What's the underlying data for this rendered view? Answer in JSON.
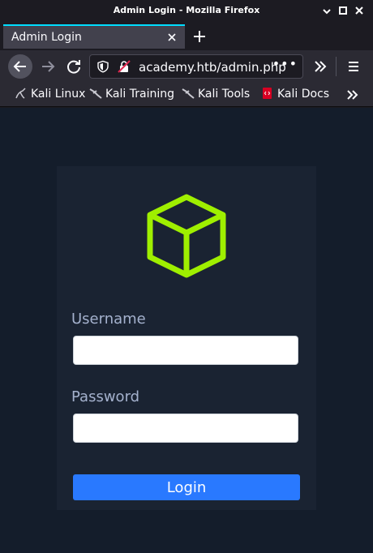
{
  "window": {
    "title": "Admin Login - Mozilla Firefox"
  },
  "tabs": [
    {
      "label": "Admin Login"
    }
  ],
  "navbar": {
    "url": "academy.htb/admin.php",
    "icons": [
      "back-arrow-icon",
      "forward-arrow-icon",
      "reload-icon",
      "shield-icon",
      "insecure-lock-icon",
      "page-actions-icon",
      "overflow-chevron-icon",
      "hamburger-menu-icon"
    ]
  },
  "bookmarks": [
    {
      "label": "Kali Linux"
    },
    {
      "label": "Kali Training"
    },
    {
      "label": "Kali Tools"
    },
    {
      "label": "Kali Docs"
    }
  ],
  "form": {
    "username_label": "Username",
    "username_value": "",
    "password_label": "Password",
    "password_value": "",
    "login_label": "Login"
  },
  "colors": {
    "accent": "#9fef00",
    "button": "#2979ff",
    "page_bg": "#141d2b",
    "card_bg": "#1a2332"
  }
}
